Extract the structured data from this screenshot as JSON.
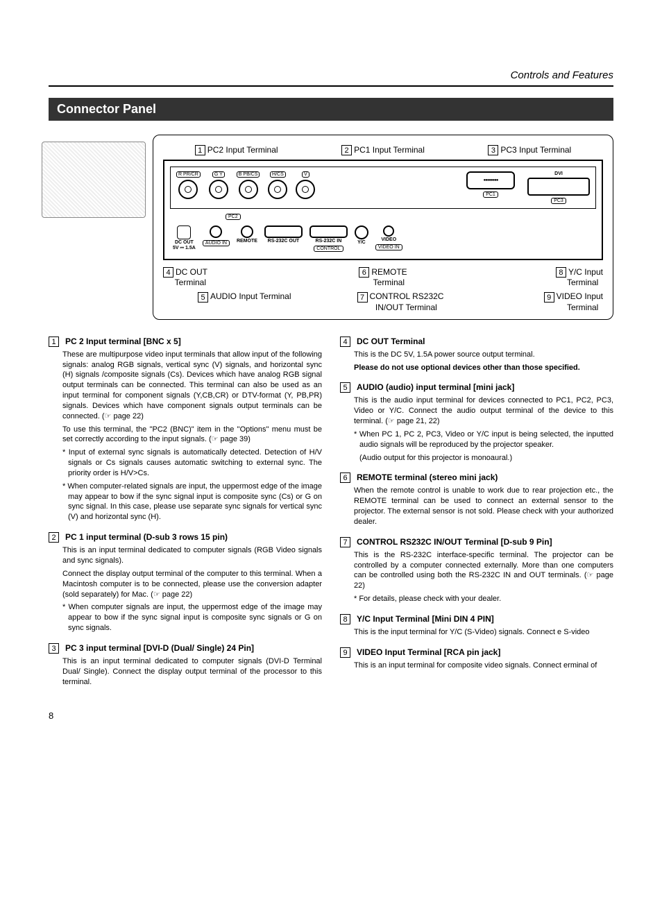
{
  "header": {
    "section": "Controls and Features"
  },
  "title": "Connector Panel",
  "callouts": {
    "c1": "PC2 Input Terminal",
    "c2": "PC1 Input Terminal",
    "c3": "PC3 Input Terminal",
    "c4a": "DC OUT",
    "c4b": "Terminal",
    "c5": "AUDIO Input Terminal",
    "c6a": "REMOTE",
    "c6b": "Terminal",
    "c7a": "CONTROL RS232C",
    "c7b": "IN/OUT Terminal",
    "c8a": "Y/C Input",
    "c8b": "Terminal",
    "c9a": "VIDEO Input",
    "c9b": "Terminal"
  },
  "panel": {
    "bnc": [
      "R PR/CR",
      "G Y",
      "B PB/CS",
      "H/CS",
      "V"
    ],
    "pc2": "PC2",
    "pc1": "PC1",
    "pc3": "PC3",
    "dvi": "DVI",
    "dcout1": "DC OUT",
    "dcout2": "5V ⎓ 1.5A",
    "audioin": "AUDIO IN",
    "remote": "REMOTE",
    "rsout": "RS-232C OUT",
    "rsin": "RS-232C IN",
    "control": "CONTROL",
    "yc": "Y/C",
    "video": "VIDEO",
    "videoin": "VIDEO IN"
  },
  "items": {
    "i1": {
      "title": "PC 2 Input terminal [BNC x 5]",
      "p1": "These are multipurpose video input terminals that allow input of the following signals: analog RGB signals, vertical sync (V) signals, and horizontal sync (H) signals /composite signals (Cs). Devices which have analog RGB signal output terminals can be connected. This terminal can also be used as an input terminal for component signals (Y,CB,CR) or DTV-format (Y, PB,PR) signals. Devices which have component signals output terminals can be connected. (☞ page 22)",
      "p2": "To use this terminal, the \"PC2 (BNC)\" item in the \"Options\" menu must be set correctly according to the input signals. (☞ page 39)",
      "n1": "* Input of external sync signals is automatically detected. Detection of H/V signals or Cs signals causes automatic switching to external sync. The priority order is H/V>Cs.",
      "n2": "* When computer-related signals are input, the uppermost edge of the image may appear to bow if the sync signal input is composite sync (Cs) or G on sync signal. In this case, please use separate sync signals for vertical sync (V) and horizontal sync (H)."
    },
    "i2": {
      "title": "PC 1 input terminal (D-sub 3 rows 15 pin)",
      "p1": "This is an input terminal dedicated to computer signals (RGB Video signals and sync signals).",
      "p2": "Connect the display output terminal of the computer to this terminal. When a Macintosh computer is to be connected, please use the conversion adapter (sold separately) for Mac. (☞ page 22)",
      "n1": "* When computer signals are input, the uppermost edge of the image may appear to bow if the sync signal input is composite sync signals or G on sync signals."
    },
    "i3": {
      "title": "PC 3 input terminal [DVI-D (Dual/ Single) 24 Pin]",
      "p1": "This is an input terminal dedicated to computer signals (DVI-D Terminal Dual/ Single). Connect the display output terminal of the processor to this terminal."
    },
    "i4": {
      "title": "DC OUT Terminal",
      "p1": "This is the DC 5V, 1.5A power source output terminal.",
      "p2": "Please do not use optional devices other than those specified."
    },
    "i5": {
      "title": "AUDIO (audio) input terminal [mini jack]",
      "p1": "This is the audio input terminal for devices connected to PC1, PC2, PC3, Video or Y/C. Connect the audio output terminal of the device to this terminal. (☞ page 21, 22)",
      "n1": "* When PC 1, PC 2, PC3, Video or Y/C input is being selected, the inputted audio signals will be reproduced by the projector speaker.",
      "n2": "(Audio output for this projector is monoaural.)"
    },
    "i6": {
      "title": "REMOTE terminal (stereo mini jack)",
      "p1": "When the remote control is unable to work due to rear projection etc., the REMOTE terminal can be used to connect an external sensor to the projector. The external sensor is not sold. Please check with your authorized dealer."
    },
    "i7": {
      "title": "CONTROL RS232C IN/OUT Terminal [D-sub 9 Pin]",
      "p1": "This is the RS-232C interface-specific terminal. The projector can be controlled by a computer connected externally. More than one computers can be controlled using both the RS-232C IN and OUT terminals. (☞ page 22)",
      "n1": "* For details, please check with your dealer."
    },
    "i8": {
      "title": "Y/C Input Terminal [Mini DIN 4 PIN]",
      "p1": "This is the input terminal for Y/C (S-Video) signals. Connect                                    e S-video"
    },
    "i9": {
      "title": "VIDEO Input Terminal [RCA pin jack]",
      "p1": "This is an input terminal for composite video signals. Connect                                                         erminal of"
    }
  },
  "pagenum": "8"
}
